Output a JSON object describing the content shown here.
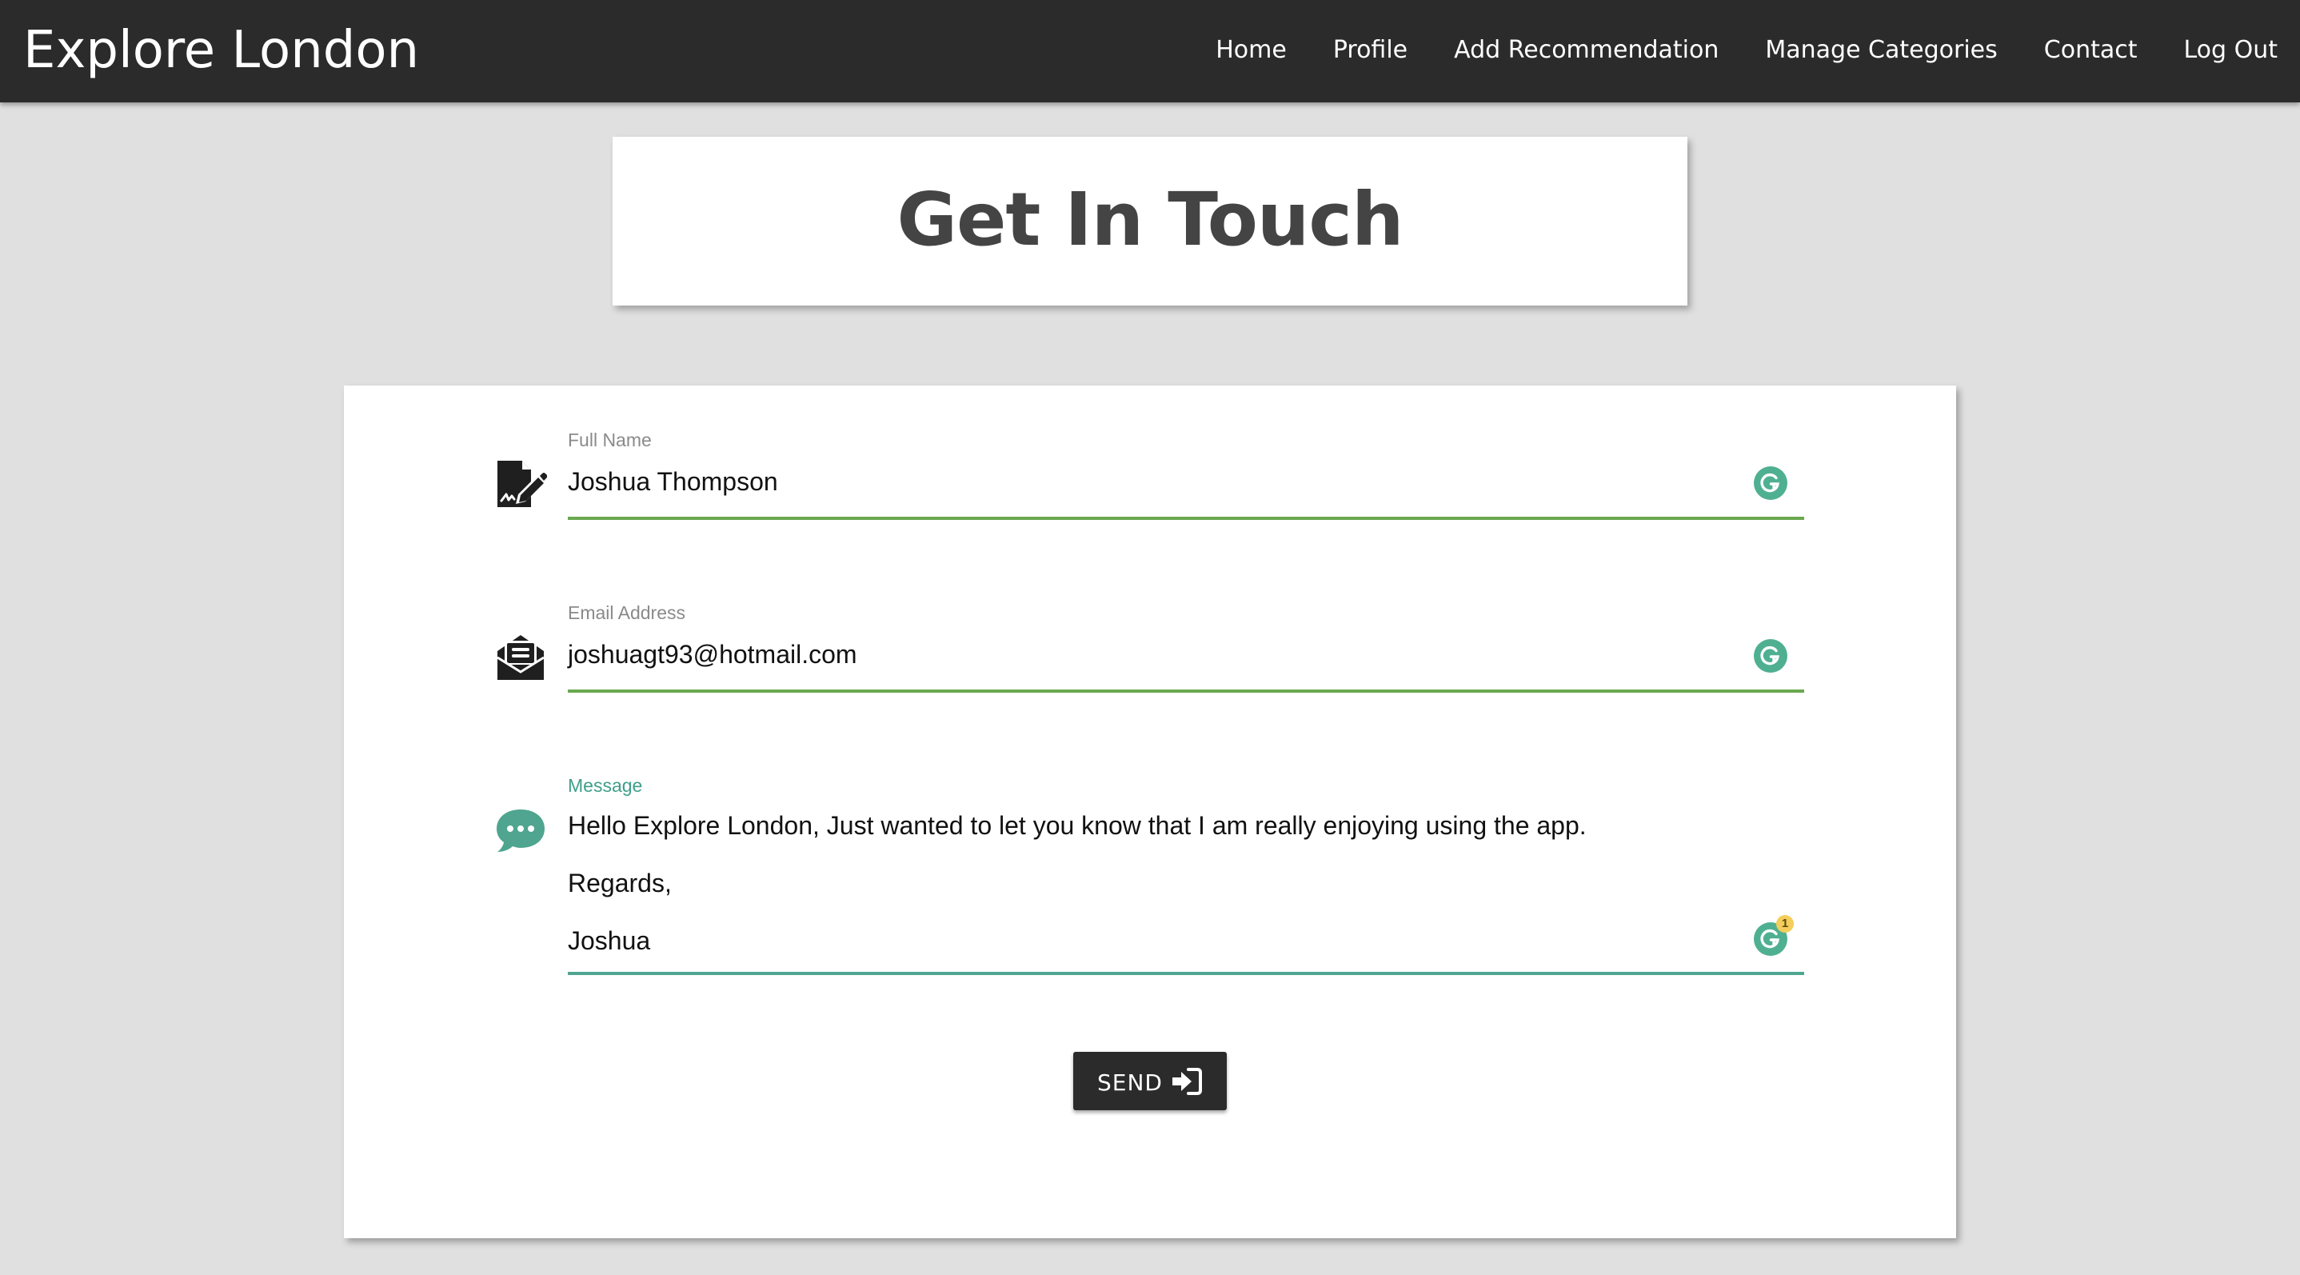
{
  "navbar": {
    "brand": "Explore London",
    "links": [
      "Home",
      "Profile",
      "Add Recommendation",
      "Manage Categories",
      "Contact",
      "Log Out"
    ]
  },
  "header": {
    "title": "Get In Touch"
  },
  "form": {
    "full_name": {
      "label": "Full Name",
      "value": "Joshua Thompson",
      "icon": "signature-edit-icon"
    },
    "email": {
      "label": "Email Address",
      "value": "joshuagt93@hotmail.com",
      "icon": "envelope-open-text-icon"
    },
    "message": {
      "label": "Message",
      "lines": [
        "Hello Explore London, Just wanted to let you know that I am really enjoying using the app.",
        "Regards,",
        "Joshua"
      ],
      "icon": "chat-bubble-icon"
    },
    "grammarly_issue_count": "1",
    "send_label": "SEND",
    "send_icon": "sign-in-icon"
  },
  "colors": {
    "navbar_bg": "#2b2b2b",
    "page_bg": "#e0e0e0",
    "underline_green": "#6aa84f",
    "accent_teal": "#4fa58f",
    "grammarly_green": "#4fb091"
  }
}
